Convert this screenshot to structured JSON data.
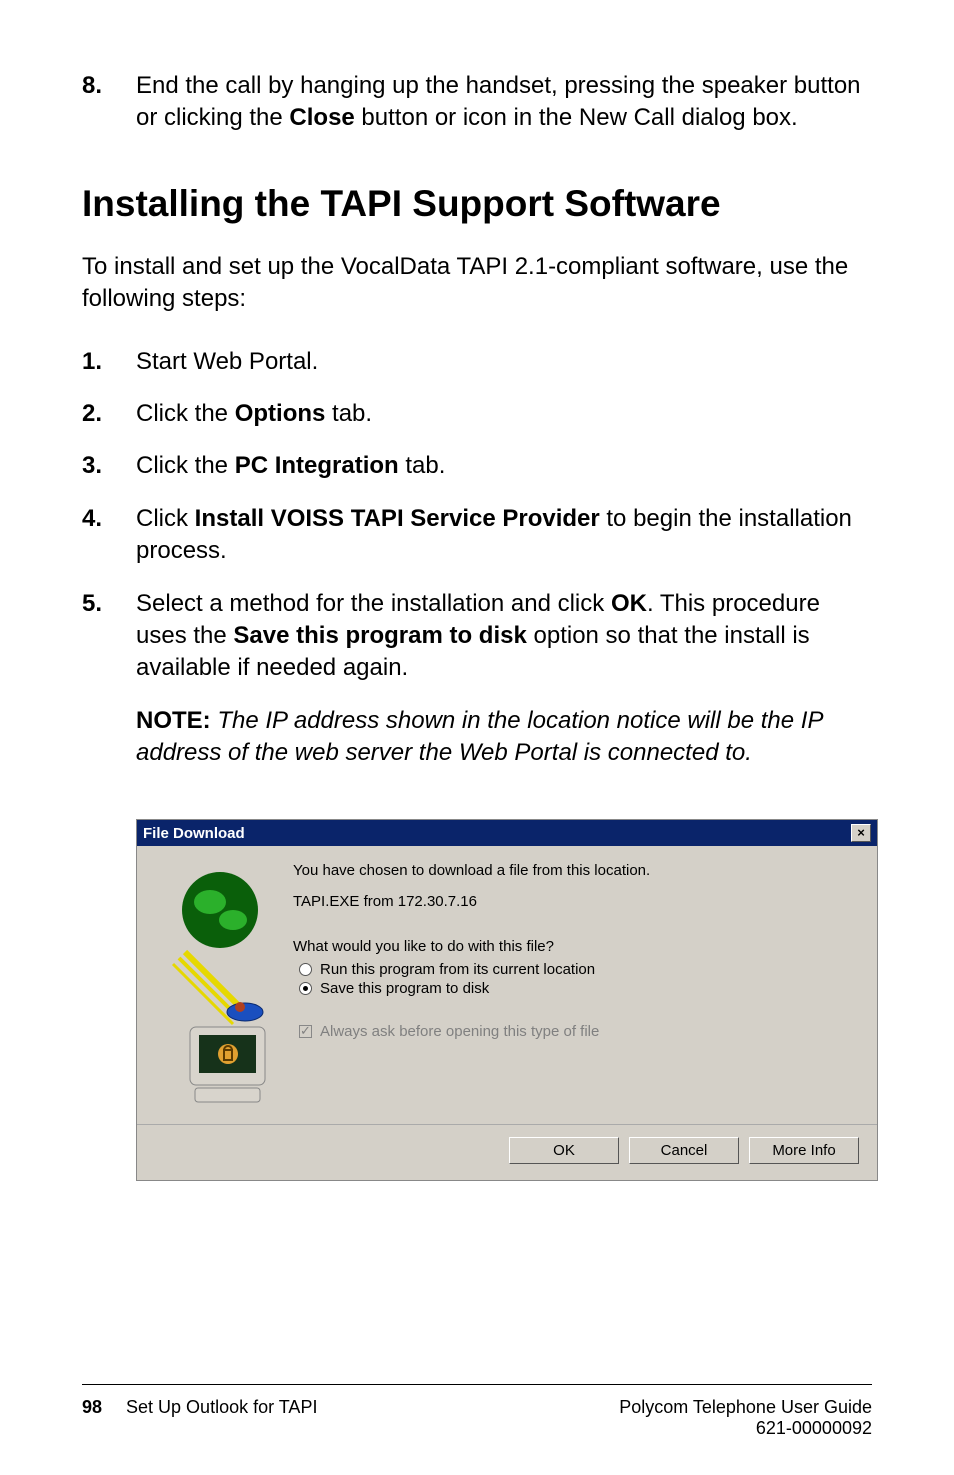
{
  "step8": {
    "num": "8.",
    "text_before": "End the call by hanging up the handset, pressing the speaker button or clicking the ",
    "bold1": "Close",
    "text_after": " button or icon in the New Call dialog box."
  },
  "heading": "Installing the TAPI Support Software",
  "intro": "To install and set up the VocalData TAPI 2.1-compliant software, use the following steps:",
  "steps": {
    "s1": {
      "num": "1.",
      "text": " Start Web Portal."
    },
    "s2": {
      "num": "2.",
      "before": "Click the ",
      "bold": "Options",
      "after": " tab."
    },
    "s3": {
      "num": "3.",
      "before": "Click the ",
      "bold": "PC Integration",
      "after": " tab."
    },
    "s4": {
      "num": "4.",
      "before": "Click ",
      "bold": "Install VOISS TAPI Service Provider",
      "after": " to begin the installation process."
    },
    "s5": {
      "num": "5.",
      "before": "Select a method for the installation and click ",
      "bold1": "OK",
      "mid": ". This procedure uses the ",
      "bold2": "Save this program to disk",
      "after": " option so that the install is available if needed again."
    }
  },
  "note": {
    "label": "NOTE:",
    "text": " The IP address shown in the location notice will be the IP address of the web server the Web Portal is connected to."
  },
  "dialog": {
    "title": "File Download",
    "close_glyph": "×",
    "msg1": "You have chosen to download a file from this location.",
    "msg2": "TAPI.EXE from 172.30.7.16",
    "question": "What would you like to do with this file?",
    "opt1": "Run this program from its current location",
    "opt2": "Save this program to disk",
    "check_label": "Always ask before opening this type of file",
    "ok": "OK",
    "cancel": "Cancel",
    "more": "More Info"
  },
  "footer": {
    "page": "98",
    "section": "Set Up Outlook for TAPI",
    "guide": "Polycom Telephone User Guide",
    "docnum": "621-00000092"
  }
}
